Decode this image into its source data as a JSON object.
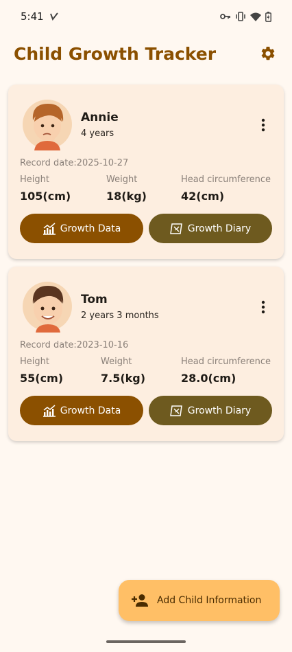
{
  "status_bar": {
    "time": "5:41",
    "icons": [
      "notification-check-icon",
      "vpn-key-icon",
      "vibrate-icon",
      "wifi-icon",
      "battery-icon"
    ]
  },
  "header": {
    "title": "Child Growth Tracker",
    "settings_icon": "gear-icon"
  },
  "children": [
    {
      "name": "Annie",
      "age": "4 years",
      "record_date": "Record date:2025-10-27",
      "metrics": {
        "height_label": "Height",
        "height_value": "105(cm)",
        "weight_label": "Weight",
        "weight_value": "18(kg)",
        "head_label": "Head circumference",
        "head_value": "42(cm)"
      },
      "buttons": {
        "data": "Growth Data",
        "diary": "Growth Diary"
      }
    },
    {
      "name": "Tom",
      "age": "2 years 3 months",
      "record_date": "Record date:2023-10-16",
      "metrics": {
        "height_label": "Height",
        "height_value": "55(cm)",
        "weight_label": "Weight",
        "weight_value": "7.5(kg)",
        "head_label": "Head circumference",
        "head_value": "28.0(cm)"
      },
      "buttons": {
        "data": "Growth Data",
        "diary": "Growth Diary"
      }
    }
  ],
  "fab": {
    "label": "Add Child Information",
    "icon": "add-person-icon"
  },
  "colors": {
    "background": "#fff8f1",
    "primary": "#8b5000",
    "secondary": "#6e5a1f",
    "card": "#fdeee0",
    "fab": "#ffbf66"
  }
}
